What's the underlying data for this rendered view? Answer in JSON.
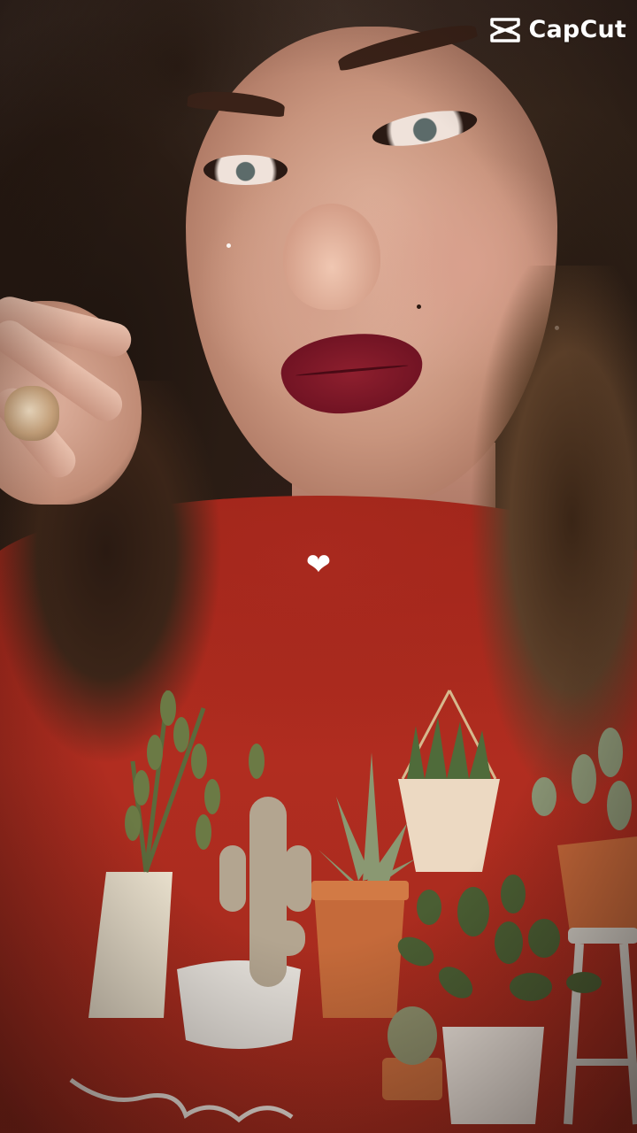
{
  "app": {
    "watermark_text": "CapCut",
    "watermark_icon": "capcut-logo-icon"
  },
  "overlay": {
    "heart_glyph": "❤",
    "heart_icon": "heart-icon"
  },
  "colors": {
    "shirt": "#b12d20",
    "lipstick": "#8e1f2e",
    "hair": "#2a1a12",
    "watermark": "#ffffff"
  }
}
